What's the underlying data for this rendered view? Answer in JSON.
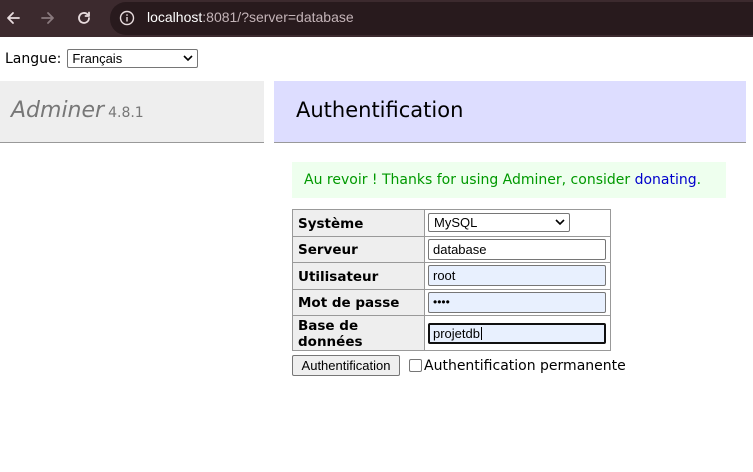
{
  "browser": {
    "url_host": "localhost",
    "url_rest": ":8081/?server=database"
  },
  "language": {
    "label": "Langue:",
    "selected": "Français"
  },
  "adminer": {
    "name": "Adminer",
    "version": "4.8.1"
  },
  "page": {
    "heading": "Authentification"
  },
  "message": {
    "text": "Au revoir ! Thanks for using Adminer, consider ",
    "link": "donating",
    "suffix": "."
  },
  "login": {
    "system_label": "Système",
    "system_value": "MySQL",
    "server_label": "Serveur",
    "server_value": "database",
    "user_label": "Utilisateur",
    "user_value": "root",
    "password_label": "Mot de passe",
    "password_mask": "••••",
    "db_label": "Base de données",
    "db_value": "projetdb"
  },
  "actions": {
    "submit_label": "Authentification",
    "permanent_label": "Authentification permanente"
  }
}
